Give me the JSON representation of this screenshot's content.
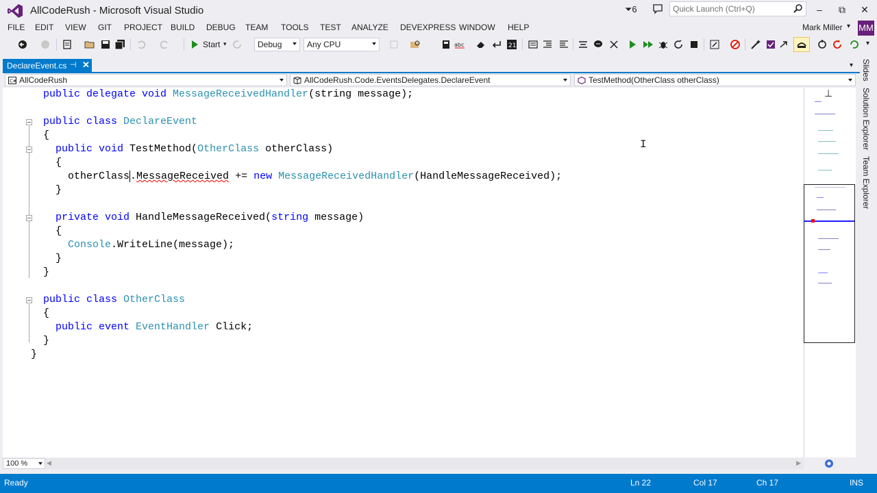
{
  "window": {
    "title": "AllCodeRush - Microsoft Visual Studio",
    "notification_count": "6",
    "quick_launch_placeholder": "Quick Launch (Ctrl+Q)",
    "minimize": "‒",
    "maximize": "⧉",
    "close": "✕"
  },
  "menu": {
    "items": [
      "FILE",
      "EDIT",
      "VIEW",
      "GIT",
      "PROJECT",
      "BUILD",
      "DEBUG",
      "TEAM",
      "TOOLS",
      "TEST",
      "ANALYZE",
      "DEVEXPRESS",
      "WINDOW",
      "HELP"
    ],
    "user_name": "Mark Miller",
    "user_initials": "MM"
  },
  "toolbar": {
    "start_label": "Start",
    "configuration": "Debug",
    "platform": "Any CPU"
  },
  "tab": {
    "label": "DeclareEvent.cs",
    "pin": "⊣",
    "close": "✕"
  },
  "navigation": {
    "project": "AllCodeRush",
    "type": "AllCodeRush.Code.EventsDelegates.DeclareEvent",
    "member": "TestMethod(OtherClass otherClass)"
  },
  "code": {
    "line1_kw": "public delegate void ",
    "line1_type": "MessageReceivedHandler",
    "line1_rest": "(string message);",
    "line3_kw": "public class ",
    "line3_type": "DeclareEvent",
    "open_brace": "{",
    "close_brace": "}",
    "line5_kw": "public void ",
    "line5_name": "TestMethod(",
    "line5_type": "OtherClass",
    "line5_rest": " otherClass)",
    "line7_a": "otherClass",
    "line7_dot": ".",
    "line7_member": "MessageReceived",
    "line7_op": " += ",
    "line7_new": "new ",
    "line7_type": "MessageReceivedHandler",
    "line7_rest": "(HandleMessageReceived);",
    "line10_kw": "private void ",
    "line10_name": "HandleMessageReceived(",
    "line10_kw2": "string",
    "line10_rest": " message)",
    "line12_type": "Console",
    "line12_rest": ".WriteLine(message);",
    "line16_kw": "public class ",
    "line16_type": "OtherClass",
    "line18_kw": "public event ",
    "line18_type": "EventHandler",
    "line18_rest": " Click;"
  },
  "editor": {
    "zoom": "100 %"
  },
  "side_tabs": [
    "Slides",
    "Solution Explorer",
    "Team Explorer"
  ],
  "status": {
    "state": "Ready",
    "line": "Ln 22",
    "col": "Col 17",
    "ch": "Ch 17",
    "mode": "INS"
  },
  "colors": {
    "accent": "#007acc",
    "keyword": "#0000ff",
    "type": "#2b91af",
    "brand": "#68217a"
  }
}
